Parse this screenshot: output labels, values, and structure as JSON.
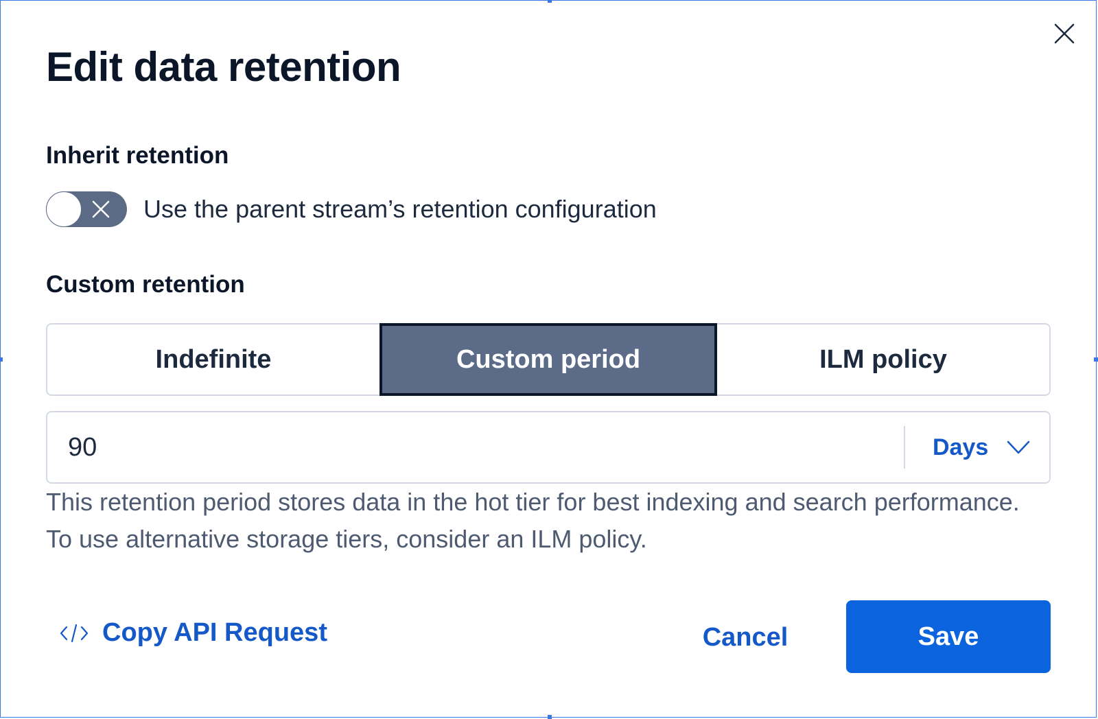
{
  "dialog": {
    "title": "Edit data retention"
  },
  "inherit": {
    "heading": "Inherit retention",
    "toggle_label": "Use the parent stream’s retention configuration",
    "enabled": false
  },
  "custom": {
    "heading": "Custom retention",
    "options": [
      {
        "label": "Indefinite",
        "selected": false
      },
      {
        "label": "Custom period",
        "selected": true
      },
      {
        "label": "ILM policy",
        "selected": false
      }
    ],
    "period_value": "90",
    "unit": "Days",
    "help_text": "This retention period stores data in the hot tier for best indexing and search performance. To use alternative storage tiers, consider an ILM policy."
  },
  "footer": {
    "copy_api_label": "Copy API Request",
    "cancel_label": "Cancel",
    "save_label": "Save"
  },
  "colors": {
    "primary": "#0b64dd",
    "link": "#1559c8",
    "selected_segment": "#5b6b88",
    "text_dark": "#0b1628",
    "text_muted": "#4d5a70",
    "border": "#d3dae6"
  }
}
